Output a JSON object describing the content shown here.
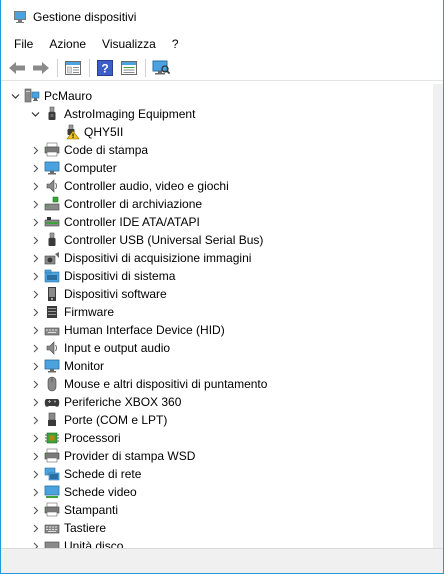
{
  "window": {
    "title": "Gestione dispositivi"
  },
  "menu": [
    "File",
    "Azione",
    "Visualizza",
    "?"
  ],
  "toolbar": [
    "back-arrow-icon",
    "forward-arrow-icon",
    "properties-view-icon",
    "help-icon",
    "details-view-icon",
    "scan-hardware-icon"
  ],
  "tree": {
    "root": "PcMauro",
    "astro_group": "AstroImaging Equipment",
    "astro_child": "QHY5II",
    "categories": [
      {
        "label": "Code di stampa",
        "icon": "printer-icon"
      },
      {
        "label": "Computer",
        "icon": "monitor-icon"
      },
      {
        "label": "Controller audio, video e giochi",
        "icon": "speaker-icon"
      },
      {
        "label": "Controller di archiviazione",
        "icon": "storage-controller-icon"
      },
      {
        "label": "Controller IDE ATA/ATAPI",
        "icon": "ide-controller-icon"
      },
      {
        "label": "Controller USB (Universal Serial Bus)",
        "icon": "usb-icon"
      },
      {
        "label": "Dispositivi di acquisizione immagini",
        "icon": "camera-icon"
      },
      {
        "label": "Dispositivi di sistema",
        "icon": "system-folder-icon"
      },
      {
        "label": "Dispositivi software",
        "icon": "software-device-icon"
      },
      {
        "label": "Firmware",
        "icon": "firmware-icon"
      },
      {
        "label": "Human Interface Device (HID)",
        "icon": "hid-icon"
      },
      {
        "label": "Input e output audio",
        "icon": "speaker-icon"
      },
      {
        "label": "Monitor",
        "icon": "monitor-icon"
      },
      {
        "label": "Mouse e altri dispositivi di puntamento",
        "icon": "mouse-icon"
      },
      {
        "label": "Periferiche XBOX 360",
        "icon": "gamepad-icon"
      },
      {
        "label": "Porte (COM e LPT)",
        "icon": "port-icon"
      },
      {
        "label": "Processori",
        "icon": "processor-icon"
      },
      {
        "label": "Provider di stampa WSD",
        "icon": "printer-icon"
      },
      {
        "label": "Schede di rete",
        "icon": "network-icon"
      },
      {
        "label": "Schede video",
        "icon": "display-adapter-icon"
      },
      {
        "label": "Stampanti",
        "icon": "printer-icon"
      },
      {
        "label": "Tastiere",
        "icon": "keyboard-icon"
      },
      {
        "label": "Unità disco",
        "icon": "disk-drive-icon"
      }
    ]
  },
  "colors": {
    "accent": "#1f9cd8",
    "warning": "#f0c419"
  }
}
